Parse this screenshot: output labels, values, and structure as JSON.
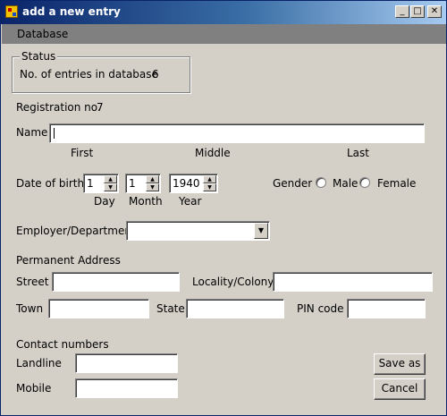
{
  "window": {
    "title": "add a new entry",
    "controls": {
      "minimize": "_",
      "maximize": "□",
      "close": "✕"
    }
  },
  "menu": {
    "items": [
      "Database"
    ]
  },
  "status": {
    "legend": "Status",
    "entries_label": "No. of entries in database",
    "entries_value": "6"
  },
  "registration": {
    "label": "Registration no.",
    "value": "7"
  },
  "name": {
    "label": "Name",
    "value": "",
    "sub_first": "First",
    "sub_middle": "Middle",
    "sub_last": "Last"
  },
  "dob": {
    "label": "Date of birth",
    "day": "1",
    "month": "1",
    "year": "1940",
    "day_label": "Day",
    "month_label": "Month",
    "year_label": "Year"
  },
  "gender": {
    "label": "Gender",
    "options": [
      "Male",
      "Female"
    ],
    "selected": null
  },
  "employer": {
    "label": "Employer/Department",
    "value": ""
  },
  "address": {
    "heading": "Permanent Address",
    "street_label": "Street",
    "locality_label": "Locality/Colony",
    "town_label": "Town",
    "state_label": "State",
    "pin_label": "PIN code"
  },
  "contact": {
    "heading": "Contact numbers",
    "landline_label": "Landline",
    "mobile_label": "Mobile"
  },
  "buttons": {
    "save": "Save as",
    "cancel": "Cancel"
  },
  "icons": {
    "spin_up": "▲",
    "spin_down": "▼",
    "dropdown": "▼"
  }
}
